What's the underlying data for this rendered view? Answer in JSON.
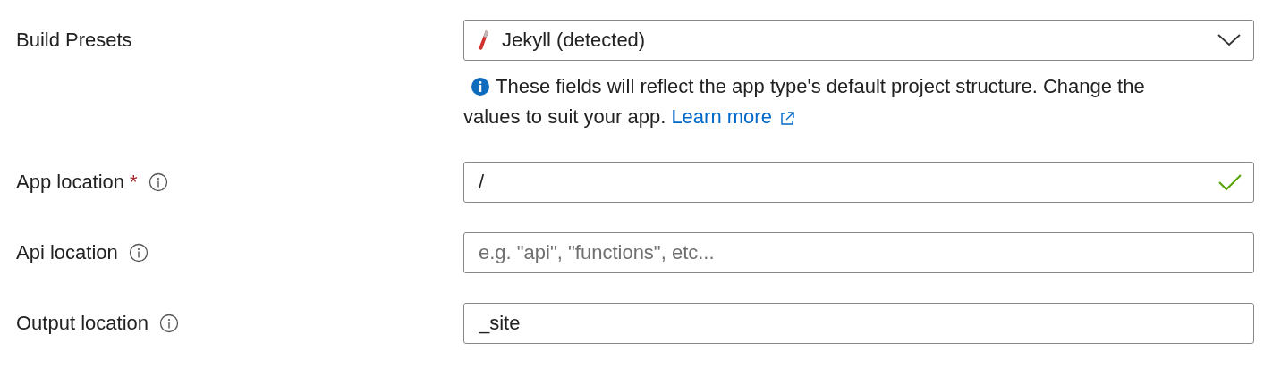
{
  "build_presets": {
    "label": "Build Presets",
    "value": "Jekyll (detected)"
  },
  "note": {
    "text": "These fields will reflect the app type's default project structure. Change the values to suit your app.",
    "link": "Learn more"
  },
  "fields": [
    {
      "label": "App location",
      "required": true,
      "required_mark": "*",
      "value": "/",
      "valid": true
    },
    {
      "label": "Api location",
      "required": false,
      "placeholder": "e.g. \"api\", \"functions\", etc...",
      "valid": false
    },
    {
      "label": "Output location",
      "required": false,
      "value": "_site",
      "valid": false
    }
  ]
}
